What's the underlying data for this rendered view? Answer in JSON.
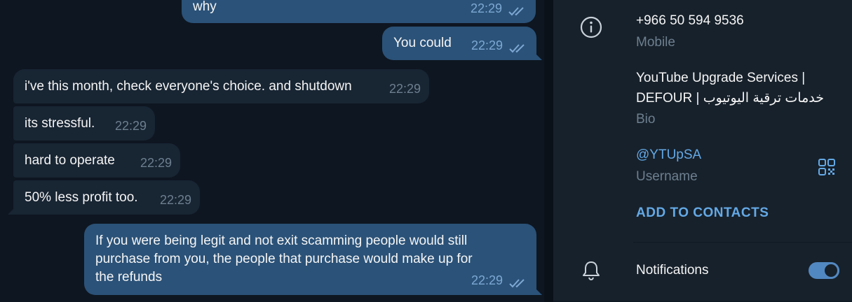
{
  "chat": {
    "messages": [
      {
        "direction": "out",
        "text": "why",
        "time": "22:29",
        "read": true
      },
      {
        "direction": "out",
        "text": "You could",
        "time": "22:29",
        "read": true
      },
      {
        "direction": "in",
        "text": "i've this month, check everyone's choice. and shutdown",
        "time": "22:29"
      },
      {
        "direction": "in",
        "text": "its stressful.",
        "time": "22:29"
      },
      {
        "direction": "in",
        "text": "hard to operate",
        "time": "22:29"
      },
      {
        "direction": "in",
        "text": "50% less profit too.",
        "time": "22:29"
      },
      {
        "direction": "out",
        "text_lines": [
          "If you were being legit and not exit scamming people would still",
          "purchase from you, the people that purchase would make up for",
          "the refunds"
        ],
        "time": "22:29",
        "read": true
      }
    ]
  },
  "profile": {
    "phone": "+966 50 594 9536",
    "phone_label": "Mobile",
    "bio_line1": "YouTube Upgrade Services |",
    "bio_line2": "DEFOUR | خدمات ترقية اليوتيوب",
    "bio_label": "Bio",
    "username": "@YTUpSA",
    "username_label": "Username",
    "add_contacts": "ADD TO CONTACTS",
    "notifications_label": "Notifications",
    "notifications_on": true
  },
  "icons": {
    "info": "info-icon",
    "qr": "qr-code-icon",
    "bell": "bell-icon",
    "ticks": "double-check-icon"
  },
  "colors": {
    "outgoing_bubble": "#2b5278",
    "incoming_bubble": "#182533",
    "accent": "#64a9e6",
    "panel_bg": "#17212b",
    "chat_bg": "#0e1621"
  }
}
